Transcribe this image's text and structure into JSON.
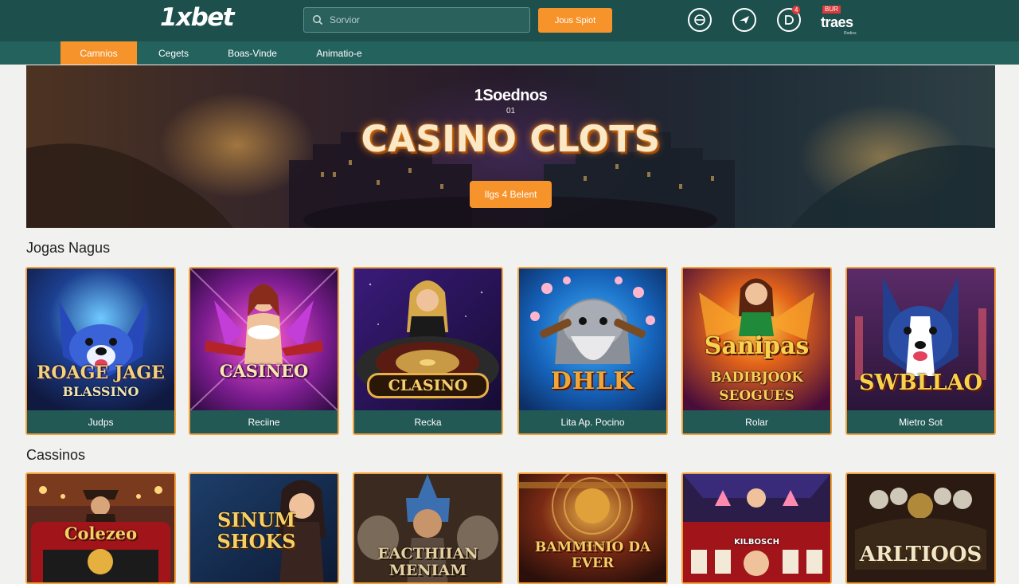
{
  "header": {
    "logo": "1xbet",
    "search_placeholder": "Sorvior",
    "cta_label": "Jous Spiot",
    "badge_text": "4",
    "brand_top": "BUR",
    "brand_name": "traes",
    "brand_sub": "Rodios",
    "icons": [
      "compass-icon",
      "send-icon",
      "deposit-icon"
    ]
  },
  "nav": {
    "tabs": [
      {
        "label": "Camnios",
        "active": true
      },
      {
        "label": "Cegets",
        "active": false
      },
      {
        "label": "Boas-Vinde",
        "active": false
      },
      {
        "label": "Animatio-e",
        "active": false
      }
    ]
  },
  "hero": {
    "eyebrow": "1Soednos",
    "sub": "01",
    "title": "CASINO CLOTS",
    "cta_label": "Ilgs 4 Belent"
  },
  "sections": {
    "games_title": "Jogas Nagus",
    "casinos_title": "Cassinos"
  },
  "games": [
    {
      "caption": "Judps",
      "art_title": "ROAGE JAGE",
      "art_sub": "BLASSINO"
    },
    {
      "caption": "Reciine",
      "art_title": "CASINEO",
      "art_sub": ""
    },
    {
      "caption": "Recka",
      "art_title": "CLASINO",
      "art_sub": ""
    },
    {
      "caption": "Lita Ap. Pocino",
      "art_title": "DHLK",
      "art_sub": ""
    },
    {
      "caption": "Rolar",
      "art_title": "Sanipas",
      "art_sub": "BADIBJOOK SEOGUES"
    },
    {
      "caption": "Mietro Sot",
      "art_title": "SWBLLAO",
      "art_sub": ""
    }
  ],
  "casinos": [
    {
      "art_title": "Colezeo"
    },
    {
      "art_title": "SINUM SHOKS"
    },
    {
      "art_title": "EACTHIIAN MENIAM"
    },
    {
      "art_title": "BAMMINIO DA EVER"
    },
    {
      "art_title": "KILBOSCH"
    },
    {
      "art_title": "ARLTIOOS"
    }
  ],
  "colors": {
    "header": "#1d4f4c",
    "nav": "#24625e",
    "accent": "#f7932b",
    "card_caption": "#235955"
  }
}
